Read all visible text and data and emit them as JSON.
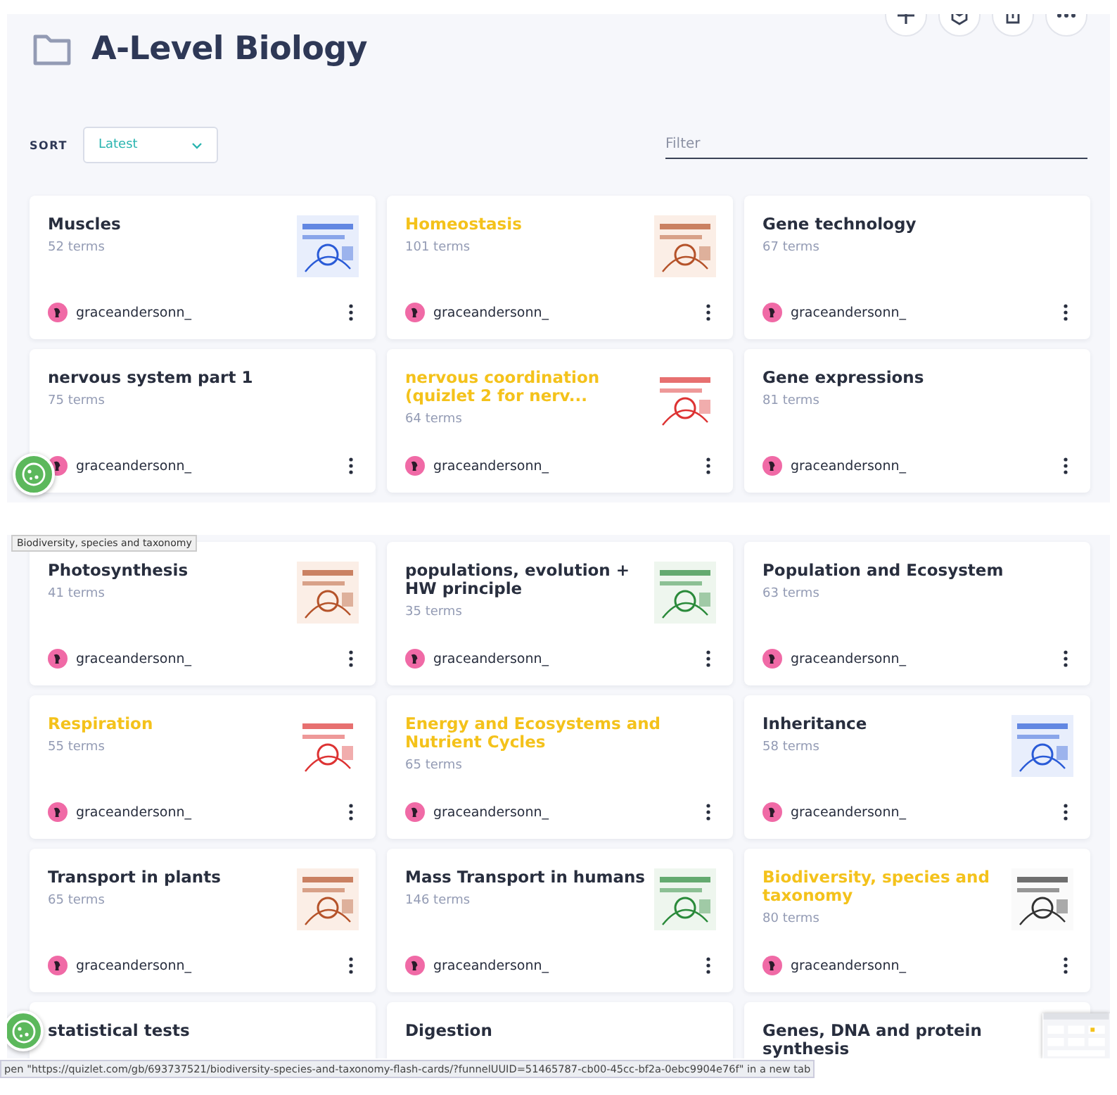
{
  "header": {
    "title": "A-Level Biology"
  },
  "sort": {
    "label": "SORT",
    "value": "Latest"
  },
  "filter": {
    "placeholder": "Filter"
  },
  "panels": [
    {
      "cards": [
        {
          "title": "Muscles",
          "terms": "52 terms",
          "author": "graceandersonn_",
          "highlighted": false,
          "thumbnail": true
        },
        {
          "title": "Homeostasis",
          "terms": "101 terms",
          "author": "graceandersonn_",
          "highlighted": true,
          "thumbnail": true
        },
        {
          "title": "Gene technology",
          "terms": "67 terms",
          "author": "graceandersonn_",
          "highlighted": false,
          "thumbnail": false
        },
        {
          "title": "nervous system part 1",
          "terms": "75 terms",
          "author": "graceandersonn_",
          "highlighted": false,
          "thumbnail": false
        },
        {
          "title": "nervous coordination (quizlet 2 for nerv...",
          "terms": "64 terms",
          "author": "graceandersonn_",
          "highlighted": true,
          "thumbnail": true
        },
        {
          "title": "Gene expressions",
          "terms": "81 terms",
          "author": "graceandersonn_",
          "highlighted": false,
          "thumbnail": false
        }
      ]
    },
    {
      "cards": [
        {
          "title": "Photosynthesis",
          "terms": "41 terms",
          "author": "graceandersonn_",
          "highlighted": false,
          "thumbnail": true
        },
        {
          "title": "populations, evolution + HW principle",
          "terms": "35 terms",
          "author": "graceandersonn_",
          "highlighted": false,
          "thumbnail": true
        },
        {
          "title": "Population and Ecosystem",
          "terms": "63 terms",
          "author": "graceandersonn_",
          "highlighted": false,
          "thumbnail": false
        },
        {
          "title": "Respiration",
          "terms": "55 terms",
          "author": "graceandersonn_",
          "highlighted": true,
          "thumbnail": true
        },
        {
          "title": "Energy and Ecosystems and Nutrient Cycles",
          "terms": "65 terms",
          "author": "graceandersonn_",
          "highlighted": true,
          "thumbnail": false
        },
        {
          "title": "Inheritance",
          "terms": "58 terms",
          "author": "graceandersonn_",
          "highlighted": false,
          "thumbnail": true
        },
        {
          "title": "Transport in plants",
          "terms": "65 terms",
          "author": "graceandersonn_",
          "highlighted": false,
          "thumbnail": true
        },
        {
          "title": "Mass Transport in humans",
          "terms": "146 terms",
          "author": "graceandersonn_",
          "highlighted": false,
          "thumbnail": true
        },
        {
          "title": "Biodiversity, species and taxonomy",
          "terms": "80 terms",
          "author": "graceandersonn_",
          "highlighted": true,
          "thumbnail": true
        },
        {
          "title": "statistical tests",
          "highlighted": false,
          "thumbnail": false
        },
        {
          "title": "Digestion",
          "highlighted": false,
          "thumbnail": false
        },
        {
          "title": "Genes, DNA and protein synthesis",
          "highlighted": false,
          "thumbnail": false
        }
      ]
    }
  ],
  "tooltip": "Biodiversity, species and taxonomy",
  "status_bar": "pen \"https://quizlet.com/gb/693737521/biodiversity-species-and-taxonomy-flash-cards/?funnelUUID=51465787-cb00-45cc-bf2a-0ebc9904e76f\" in a new tab"
}
